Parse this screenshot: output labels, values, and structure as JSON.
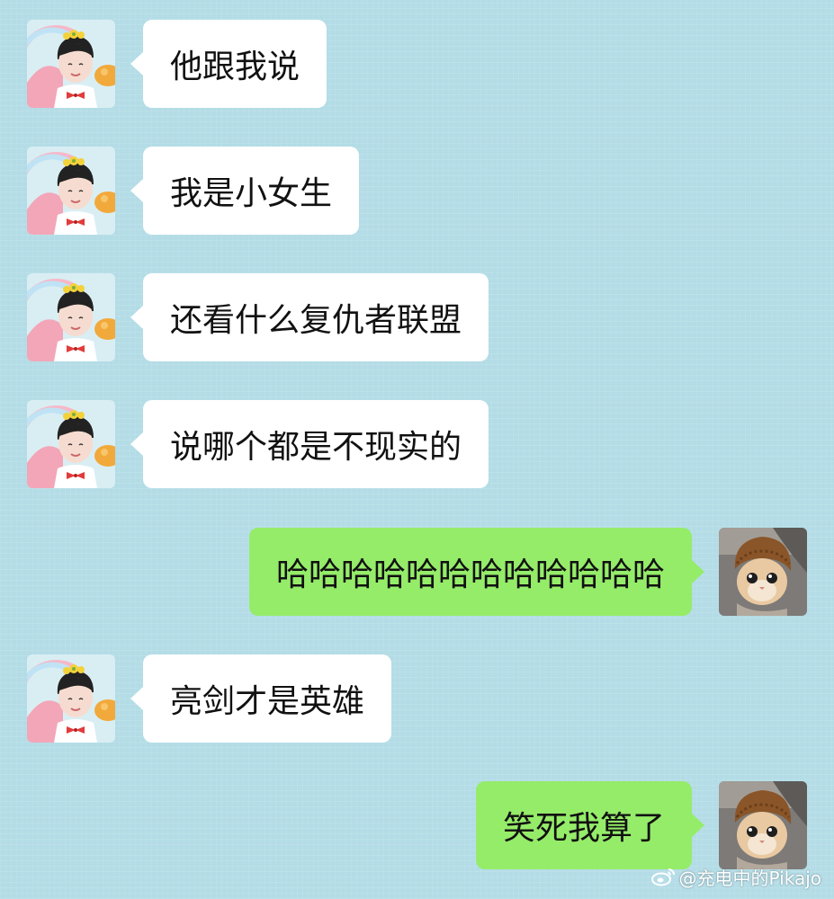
{
  "contacts": {
    "friend": {
      "avatar_icon": "boy-with-flower-crown-avatar-icon"
    },
    "me": {
      "avatar_icon": "cat-in-knit-hat-avatar-icon"
    }
  },
  "messages": [
    {
      "from": "friend",
      "text": "他跟我说"
    },
    {
      "from": "friend",
      "text": "我是小女生"
    },
    {
      "from": "friend",
      "text": "还看什么复仇者联盟"
    },
    {
      "from": "friend",
      "text": "说哪个都是不现实的"
    },
    {
      "from": "me",
      "text": "哈哈哈哈哈哈哈哈哈哈哈哈"
    },
    {
      "from": "friend",
      "text": "亮剑才是英雄"
    },
    {
      "from": "me",
      "text": "笑死我算了"
    }
  ],
  "watermark": {
    "text": "@充电中的Pikajo",
    "icon": "weibo-logo-icon"
  },
  "colors": {
    "background": "#b3dce6",
    "incoming_bubble": "#ffffff",
    "outgoing_bubble": "#95ec69"
  }
}
